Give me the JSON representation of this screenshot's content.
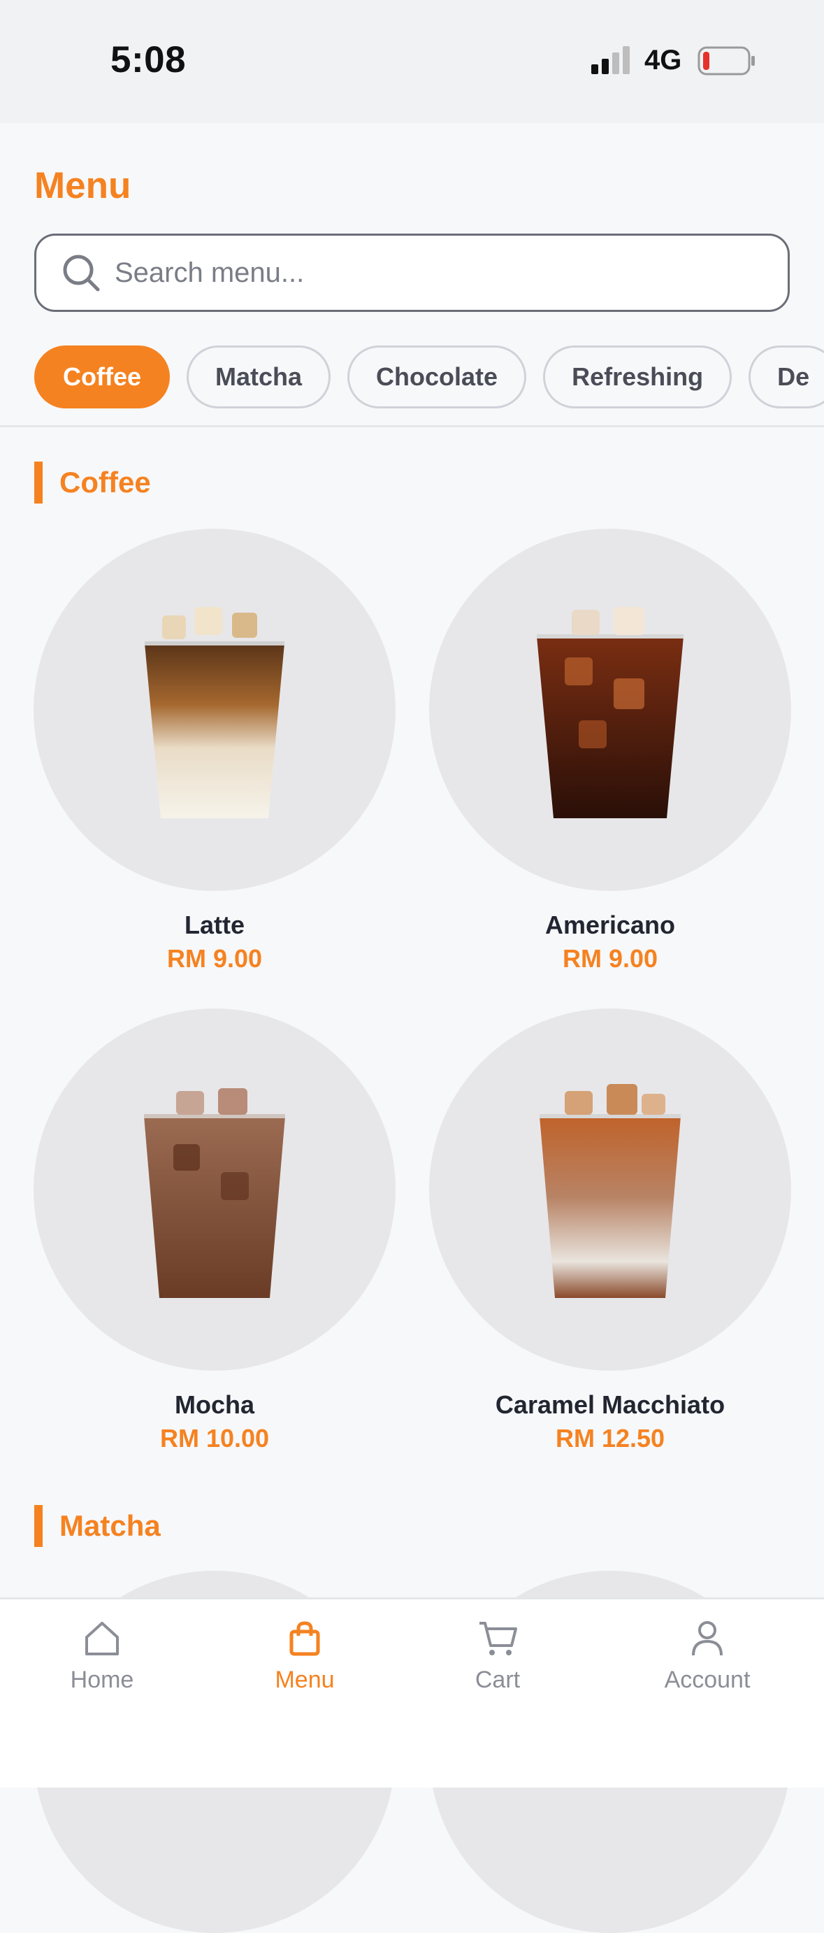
{
  "status_bar": {
    "time": "5:08",
    "network": "4G",
    "battery_color": "#e5322b"
  },
  "header": {
    "title": "Menu"
  },
  "search": {
    "placeholder": "Search menu..."
  },
  "categories": [
    {
      "label": "Coffee",
      "active": true
    },
    {
      "label": "Matcha",
      "active": false
    },
    {
      "label": "Chocolate",
      "active": false
    },
    {
      "label": "Refreshing",
      "active": false
    },
    {
      "label": "De",
      "active": false
    }
  ],
  "sections": [
    {
      "title": "Coffee",
      "items": [
        {
          "name": "Latte",
          "price": "RM 9.00",
          "icon": "iced-latte-image"
        },
        {
          "name": "Americano",
          "price": "RM 9.00",
          "icon": "iced-americano-image"
        },
        {
          "name": "Mocha",
          "price": "RM 10.00",
          "icon": "iced-mocha-image"
        },
        {
          "name": "Caramel Macchiato",
          "price": "RM 12.50",
          "icon": "iced-caramel-macchiato-image"
        }
      ]
    },
    {
      "title": "Matcha"
    }
  ],
  "tab_bar": {
    "items": [
      {
        "label": "Home",
        "icon": "home-icon",
        "active": false
      },
      {
        "label": "Menu",
        "icon": "shopping-bag-icon",
        "active": true
      },
      {
        "label": "Cart",
        "icon": "cart-icon",
        "active": false
      },
      {
        "label": "Account",
        "icon": "user-icon",
        "active": false
      }
    ]
  },
  "colors": {
    "accent": "#f58220",
    "text_dark": "#222631",
    "muted": "#8b8e96"
  }
}
